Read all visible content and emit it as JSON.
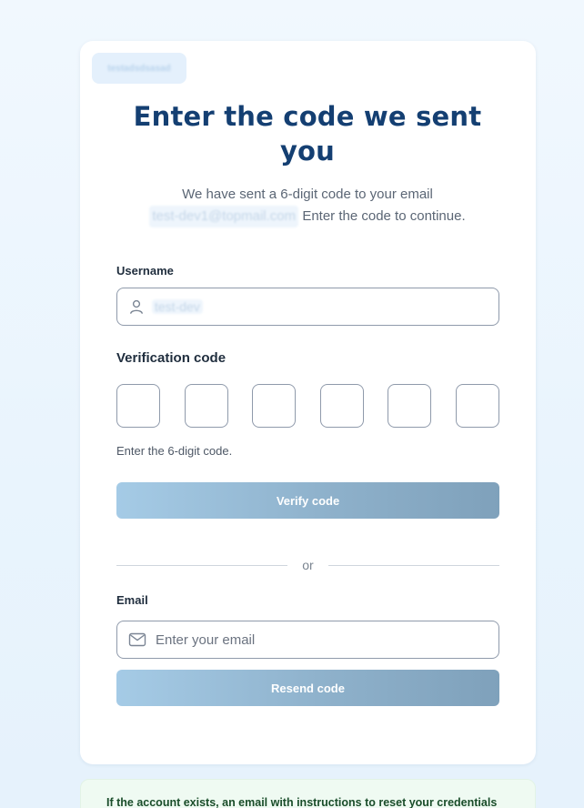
{
  "brand": {
    "name": "testadsdsasad"
  },
  "title": "Enter the code we sent you",
  "subtitle": {
    "before": "We have sent a 6-digit code to your email ",
    "email": "test-dev1@topmail.com",
    "after": " Enter the code to continue."
  },
  "username": {
    "label": "Username",
    "value": "test-dev",
    "icon": "user-icon"
  },
  "verification": {
    "label": "Verification code",
    "digits": [
      "",
      "",
      "",
      "",
      "",
      ""
    ],
    "helper": "Enter the 6-digit code.",
    "button": "Verify code"
  },
  "divider": {
    "text": "or"
  },
  "email": {
    "label": "Email",
    "placeholder": "Enter your email",
    "icon": "mail-icon",
    "button": "Resend code"
  },
  "notice": {
    "text": "If the account exists, an email with instructions to reset your credentials"
  },
  "colors": {
    "title": "#143f72",
    "button_start": "#a5cbe6",
    "button_end": "#7fa1bb",
    "notice_bg": "#effaf2",
    "notice_text": "#1a4d2a"
  }
}
